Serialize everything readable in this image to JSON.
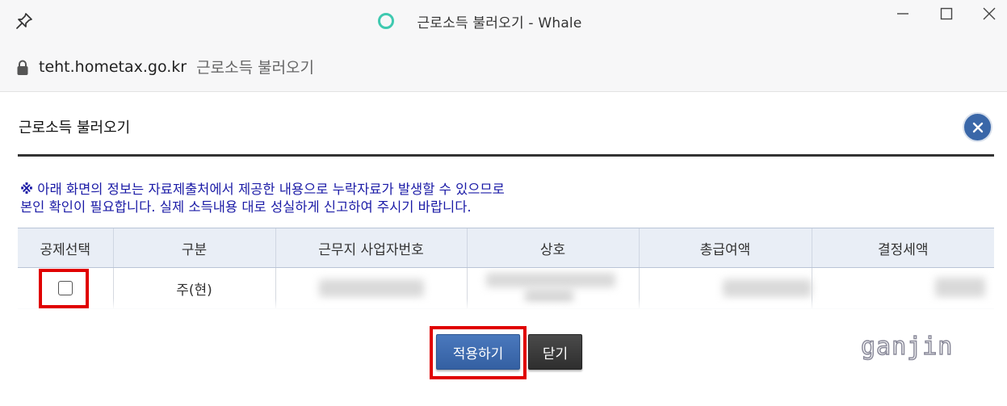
{
  "window": {
    "title": "근로소득 불러오기 - Whale",
    "min_label": "–",
    "max_label": "☐",
    "close_label": "✕"
  },
  "address_bar": {
    "domain": "teht.hometax.go.kr",
    "page_title": "근로소득 불러오기"
  },
  "popup": {
    "title": "근로소득 불러오기",
    "close_symbol": "×",
    "notice_mark": "※",
    "notice_line1": " 아래 화면의 정보는 자료제출처에서 제공한 내용으로 누락자료가 발생할 수 있으므로",
    "notice_line2": "본인 확인이 필요합니다. 실제 소득내용 대로 성실하게 신고하여 주시기 바랍니다.",
    "table": {
      "headers": [
        "공제선택",
        "구분",
        "근무지 사업자번호",
        "상호",
        "총급여액",
        "결정세액"
      ],
      "rows": [
        {
          "selected": false,
          "category": "주(현)"
        }
      ]
    },
    "apply_button": "적용하기",
    "close_button": "닫기"
  },
  "watermark": "ganjin",
  "colors": {
    "notice_text": "#1a1aa6",
    "apply_button": "#3a67a8",
    "close_button": "#333333",
    "highlight_red": "#e00000",
    "header_bg": "#e9eef6"
  }
}
